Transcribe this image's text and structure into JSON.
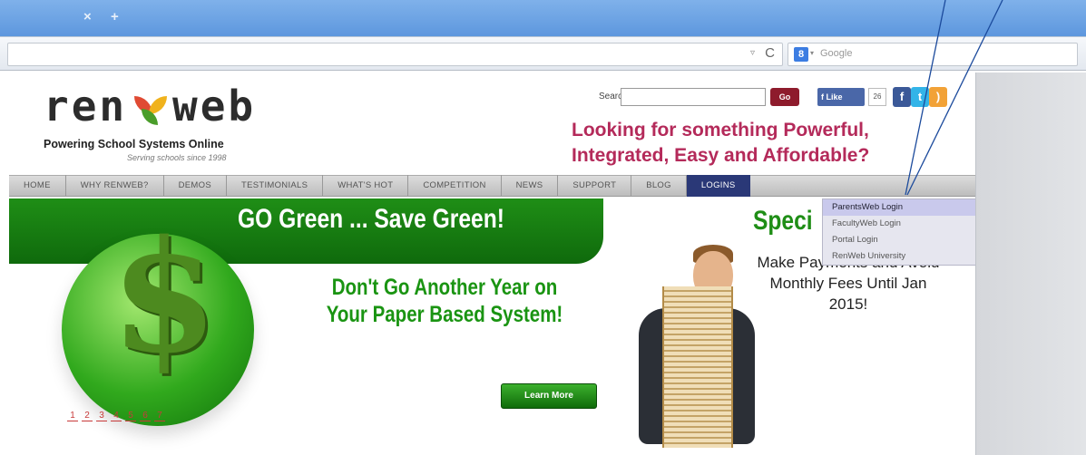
{
  "browser": {
    "tab_close": "×",
    "new_tab": "+",
    "reload": "C",
    "url_dropdown": "▿",
    "search_engine_icon": "8",
    "search_placeholder": "Google"
  },
  "site": {
    "logo_left": "ren",
    "logo_right": "web",
    "tagline": "Powering School Systems Online",
    "since": "Serving schools since 1998",
    "search_label": "Search:",
    "go_label": "Go",
    "fb_like": "Like",
    "fb_count": "26",
    "promo": "Looking for something Powerful, Integrated, Easy and Affordable?"
  },
  "nav": {
    "items": [
      "HOME",
      "WHY RENWEB?",
      "DEMOS",
      "TESTIMONIALS",
      "WHAT'S HOT",
      "COMPETITION",
      "NEWS",
      "SUPPORT",
      "BLOG",
      "LOGINS"
    ]
  },
  "logins_menu": {
    "items": [
      "ParentsWeb Login",
      "FacultyWeb Login",
      "Portal Login",
      "RenWeb University"
    ]
  },
  "banner": {
    "title": "GO Green ... Save Green!",
    "subhead_line1": "Don't Go Another Year on",
    "subhead_line2": "Your Paper Based System!",
    "learn_more": "Learn More",
    "pages": [
      "1",
      "2",
      "3",
      "4",
      "5",
      "6",
      "7"
    ],
    "special_title": "Speci",
    "special_body": "Make Payments and Avoid Monthly Fees Until Jan 2015!"
  },
  "colors": {
    "browser_blue": "#5d97de",
    "brand_green": "#1f8e16",
    "promo_pink": "#b42a5a",
    "logins_active": "#2a3877"
  }
}
